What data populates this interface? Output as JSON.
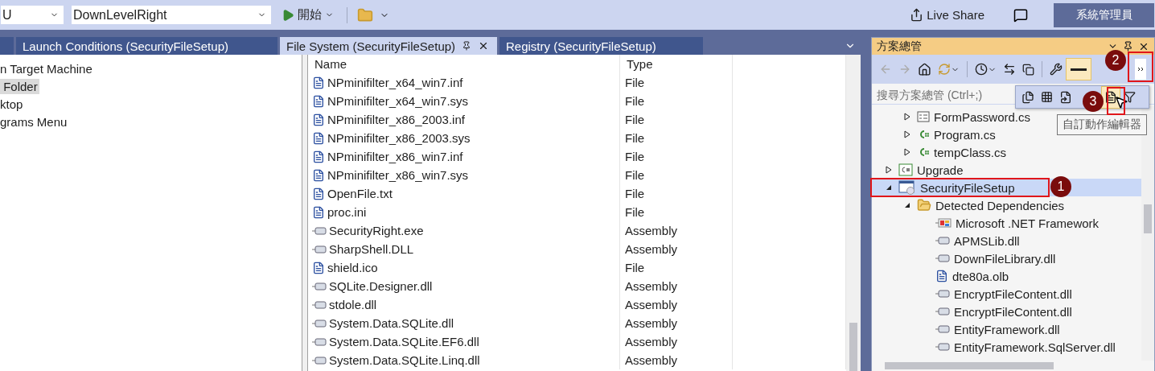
{
  "toolbar": {
    "config_combo": "U",
    "project_combo": "DownLevelRight",
    "start_button": "開始",
    "live_share": "Live Share",
    "admin_button": "系統管理員"
  },
  "tabs": [
    {
      "selected": false
    },
    {
      "label": "Launch Conditions (SecurityFileSetup)",
      "selected": false
    },
    {
      "label": "File System (SecurityFileSetup)",
      "selected": true
    },
    {
      "label": "Registry (SecurityFileSetup)",
      "selected": false
    }
  ],
  "folder_tree": [
    {
      "label": "n Target Machine",
      "selected": false
    },
    {
      "label": " Folder",
      "selected": true
    },
    {
      "label": "ktop",
      "selected": false
    },
    {
      "label": "grams Menu",
      "selected": false
    }
  ],
  "file_list": {
    "columns": [
      "Name",
      "Type"
    ],
    "rows": [
      {
        "name": "NPminifilter_x64_win7.inf",
        "type": "File",
        "kind": "document"
      },
      {
        "name": "NPminifilter_x64_win7.sys",
        "type": "File",
        "kind": "document"
      },
      {
        "name": "NPminifilter_x86_2003.inf",
        "type": "File",
        "kind": "document"
      },
      {
        "name": "NPminifilter_x86_2003.sys",
        "type": "File",
        "kind": "document"
      },
      {
        "name": "NPminifilter_x86_win7.inf",
        "type": "File",
        "kind": "document"
      },
      {
        "name": "NPminifilter_x86_win7.sys",
        "type": "File",
        "kind": "document"
      },
      {
        "name": "OpenFile.txt",
        "type": "File",
        "kind": "document"
      },
      {
        "name": "proc.ini",
        "type": "File",
        "kind": "document"
      },
      {
        "name": "SecurityRight.exe",
        "type": "Assembly",
        "kind": "assembly"
      },
      {
        "name": "SharpShell.DLL",
        "type": "Assembly",
        "kind": "assembly"
      },
      {
        "name": "shield.ico",
        "type": "File",
        "kind": "document"
      },
      {
        "name": "SQLite.Designer.dll",
        "type": "Assembly",
        "kind": "assembly"
      },
      {
        "name": "stdole.dll",
        "type": "Assembly",
        "kind": "assembly"
      },
      {
        "name": "System.Data.SQLite.dll",
        "type": "Assembly",
        "kind": "assembly"
      },
      {
        "name": "System.Data.SQLite.EF6.dll",
        "type": "Assembly",
        "kind": "assembly"
      },
      {
        "name": "System.Data.SQLite.Linq.dll",
        "type": "Assembly",
        "kind": "assembly"
      }
    ]
  },
  "solution_explorer": {
    "title": "方案總管",
    "search": {
      "placeholder": "搜尋方案總管 (Ctrl+;)"
    },
    "tree": [
      {
        "children": [
          {
            "label": "FormPassword.cs",
            "kind": "form",
            "expanded": false,
            "selected": false
          },
          {
            "label": "Program.cs",
            "kind": "csharp",
            "expanded": false,
            "selected": false
          },
          {
            "label": "tempClass.cs",
            "kind": "csharp",
            "expanded": false,
            "selected": false
          }
        ]
      },
      {
        "label": "Upgrade",
        "kind": "project",
        "expanded": false,
        "selected": false
      },
      {
        "label": "SecurityFileSetup",
        "kind": "setup",
        "expanded": true,
        "selected": true,
        "children": [
          {
            "label": "Detected Dependencies",
            "kind": "folder",
            "expanded": true,
            "selected": false,
            "children": [
              {
                "label": "Microsoft .NET Framework",
                "kind": "framework",
                "selected": false
              },
              {
                "label": "APMSLib.dll",
                "kind": "assembly",
                "selected": false
              },
              {
                "label": "DownFileLibrary.dll",
                "kind": "assembly",
                "selected": false
              },
              {
                "label": "dte80a.olb",
                "kind": "document",
                "selected": false
              },
              {
                "label": "EncryptFileContent.dll",
                "kind": "assembly",
                "selected": false
              },
              {
                "label": "EncryptFileContent.dll",
                "kind": "assembly",
                "selected": false
              },
              {
                "label": "EntityFramework.dll",
                "kind": "assembly",
                "selected": false
              },
              {
                "label": "EntityFramework.SqlServer.dll",
                "kind": "assembly",
                "selected": false
              }
            ]
          }
        ]
      }
    ],
    "tooltip": "自訂動作編輯器"
  },
  "annotations": [
    {
      "label": "1"
    },
    {
      "label": "2"
    },
    {
      "label": "3"
    }
  ]
}
